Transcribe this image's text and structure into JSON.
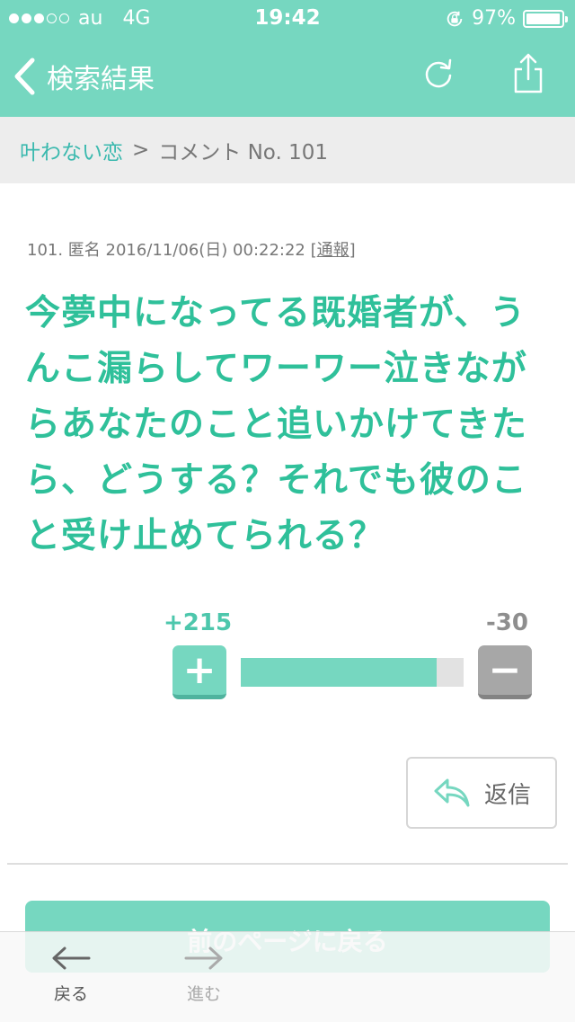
{
  "status_bar": {
    "carrier": "au",
    "network": "4G",
    "time": "19:42",
    "battery_percent": "97%",
    "battery_level": 0.97,
    "signal_bars_filled": 3,
    "signal_bars_total": 5
  },
  "nav": {
    "back_title": "検索結果",
    "icons": [
      "chevron-left-icon",
      "refresh-icon",
      "share-icon"
    ]
  },
  "breadcrumb": {
    "parent": "叶わない恋",
    "separator": ">",
    "current": "コメント No. 101"
  },
  "comment": {
    "meta": "101. 匿名 2016/11/06(日) 00:22:22",
    "report_label": "通報",
    "body": "今夢中になってる既婚者が、うんこ漏らしてワーワー泣きながらあなたのこと追いかけてきたら、どうする？それでも彼のこと受け止めてられる？"
  },
  "votes": {
    "plus_count": "+215",
    "minus_count": "-30",
    "plus_symbol": "+",
    "minus_symbol": "−",
    "plus_ratio": 0.878
  },
  "reply_label": "返信",
  "back_page_label": "前のページに戻る",
  "toolbar": {
    "back_label": "戻る",
    "forward_label": "進む"
  },
  "colors": {
    "brand": "#76d7c0",
    "comment_text": "#2fc09a",
    "link": "#3ab9ae",
    "minus_gray": "#a7a7a7"
  }
}
